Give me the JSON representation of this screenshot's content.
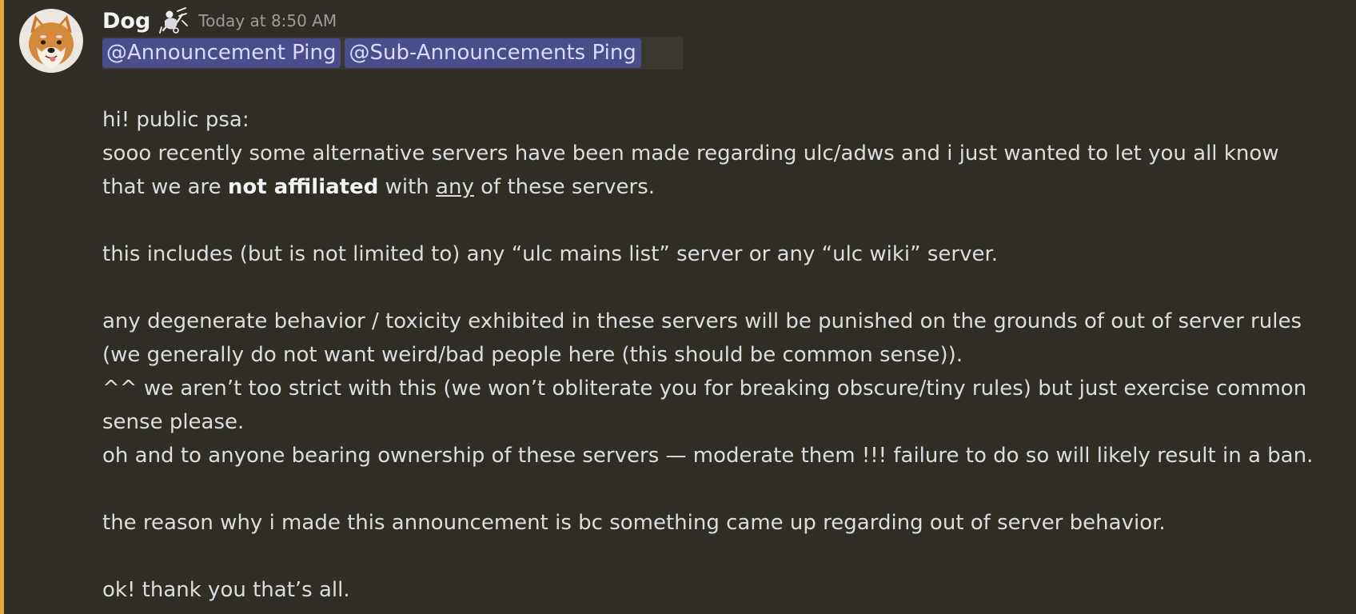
{
  "message": {
    "author": "Dog",
    "timestamp": "Today at 8:50 AM",
    "avatar_icon": "shiba-dog-avatar",
    "role_icon": "rider-icon",
    "accent_color": "#e8a63a",
    "mentions": [
      {
        "label": "@Announcement Ping"
      },
      {
        "label": "@Sub-Announcements Ping"
      }
    ],
    "lines": {
      "l1": "hi! public psa:",
      "l2": "sooo recently some alternative servers have been made regarding ulc/adws and i just wanted to let you all know",
      "l3_a": "that we are ",
      "l3_bold": "not affiliated",
      "l3_b": " with ",
      "l3_underline": "any",
      "l3_c": " of these servers.",
      "l4": "this includes (but is not limited to) any “ulc mains list” server or any “ulc wiki” server.",
      "l5": "any degenerate behavior / toxicity exhibited in these servers will be punished on the grounds of out of server rules",
      "l6": "(we generally do not want weird/bad people here (this should be common sense)).",
      "l7": "^^ we aren’t too strict with this (we won’t obliterate you for breaking obscure/tiny rules) but just exercise common",
      "l8": "sense please.",
      "l9": "oh and to anyone bearing ownership of these servers — moderate them !!! failure to do so will likely result in a ban.",
      "l10": "the reason why i made this announcement is bc something came up regarding out of server behavior.",
      "l11": "ok! thank you that’s all."
    }
  }
}
